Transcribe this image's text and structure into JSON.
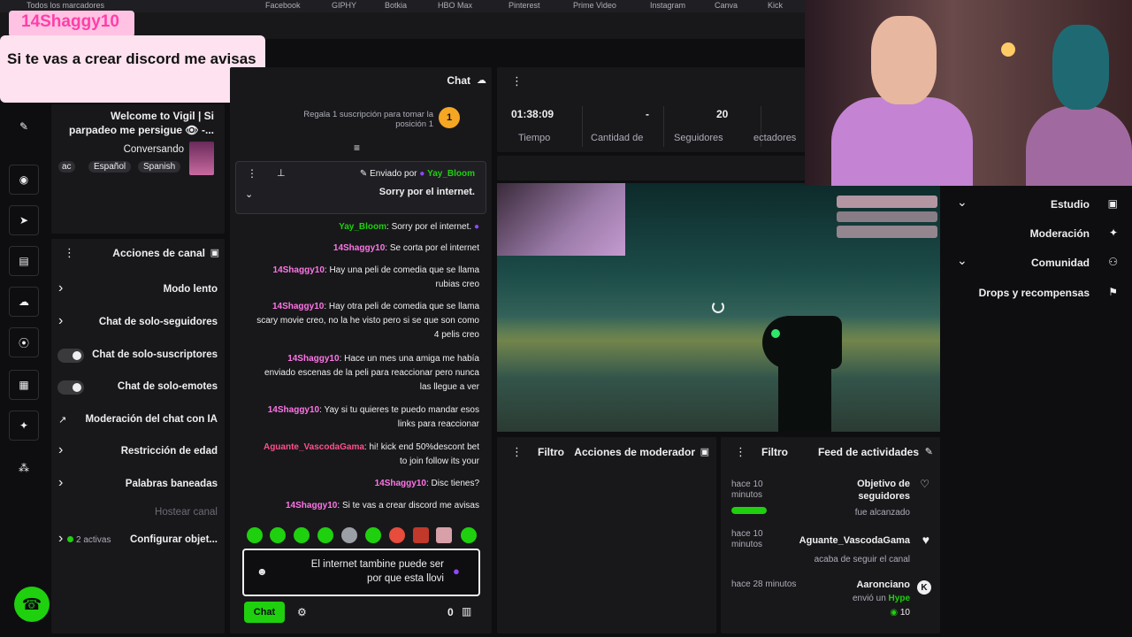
{
  "bookmarks": [
    "Todos los marcadores",
    "Facebook",
    "GIPHY",
    "Botkia",
    "HBO Max",
    "Pinterest",
    "Prime Video",
    "Instagram",
    "Canva",
    "Kick"
  ],
  "overlay": {
    "username": "14Shaggy10",
    "message": "Si te vas a crear discord me avisas"
  },
  "stream_info": {
    "title": "Welcome to Vigil | Si parpadeo me persigue 👁 -...",
    "category": "Conversando",
    "tags": [
      "Spanish",
      "Español",
      "ac"
    ]
  },
  "channel_actions": {
    "title": "Acciones de canal",
    "items": [
      {
        "label": "Modo lento"
      },
      {
        "label": "Chat de solo-seguidores"
      },
      {
        "label": "Chat de solo-suscriptores"
      },
      {
        "label": "Chat de solo-emotes"
      },
      {
        "label": "Moderación del chat con IA"
      },
      {
        "label": "Restricción de edad"
      },
      {
        "label": "Palabras baneadas"
      },
      {
        "label": "Hostear canal"
      },
      {
        "label": "Configurar objet...",
        "badge": "2 activas"
      }
    ]
  },
  "chat": {
    "title": "Chat",
    "gift_text": "Regala 1 suscripción para tomar la posición 1",
    "gift_rank": "1",
    "pinned": {
      "by_prefix": "Enviado por",
      "by": "Yay_Bloom",
      "text": "Sorry por el internet."
    },
    "messages": [
      {
        "user": "Yay_Bloom",
        "text": "Sorry por el internet."
      },
      {
        "user": "14Shaggy10",
        "text": "Se corta por el internet"
      },
      {
        "user": "14Shaggy10",
        "text": "Hay una peli de comedia que se llama rubias creo"
      },
      {
        "user": "14Shaggy10",
        "text": "Hay otra peli de comedia que se llama scary movie creo, no la he visto pero si se que son como 4 pelis creo"
      },
      {
        "user": "14Shaggy10",
        "text": "Hace un mes una amiga me había enviado escenas de la peli para reaccionar pero nunca las llegue a ver"
      },
      {
        "user": "14Shaggy10",
        "text": "Yay si tu quieres te puedo mandar esos links para reaccionar"
      },
      {
        "user": "Aguante_VascodaGama",
        "text": "hi! kick end 50%descont bet to join follow its your"
      },
      {
        "user": "14Shaggy10",
        "text": "Disc tienes?"
      },
      {
        "user": "14Shaggy10",
        "text": "Si te vas a crear discord me avisas"
      }
    ],
    "input_value": "El internet tambine puede ser por que esta llovi",
    "points": "0",
    "send_label": "Chat"
  },
  "stats": [
    {
      "value": "20",
      "label": "Seguidores"
    },
    {
      "value": "-",
      "label": "Cantidad de"
    },
    {
      "value": "01:38:09",
      "label": "Tiempo"
    }
  ],
  "stats_partial_label": "ectadores",
  "mod_actions": {
    "title": "Acciones de moderador",
    "filter": "Filtro"
  },
  "activity": {
    "title": "Feed de actividades",
    "filter": "Filtro",
    "items": [
      {
        "title": "Objetivo de seguidores",
        "sub": "fue alcanzado",
        "time": "hace 10 minutos",
        "progress": 1.0
      },
      {
        "title": "Aguante_VascodaGama",
        "sub": "acaba de seguir el canal",
        "time": "hace 10 minutos"
      },
      {
        "title": "Aaronciano",
        "sub_prefix": "envió un",
        "sub_hl": "Hype",
        "amount": "10",
        "time": "hace 28 minutos"
      }
    ]
  },
  "right_nav": [
    {
      "label": "Estudio",
      "expand": true
    },
    {
      "label": "Moderación",
      "expand": false
    },
    {
      "label": "Comunidad",
      "expand": true
    },
    {
      "label": "Drops y recompensas",
      "expand": false
    }
  ],
  "colors": {
    "accent": "#1fd00e",
    "purple": "#9147ff",
    "panel": "#18181b",
    "username": "#ff75e6"
  }
}
